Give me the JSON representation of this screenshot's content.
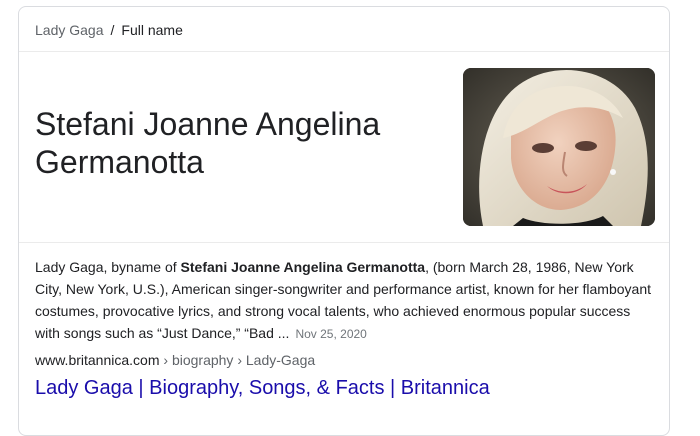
{
  "breadcrumb": {
    "parent": "Lady Gaga",
    "separator": "/",
    "current": "Full name"
  },
  "answer": {
    "full_name": "Stefani Joanne Angelina Germanotta"
  },
  "snippet": {
    "text_before": "Lady Gaga, byname of ",
    "bold": "Stefani Joanne Angelina Germanotta",
    "text_after": ", (born March 28, 1986, New York City, New York, U.S.), American singer-songwriter and performance artist, known for her flamboyant costumes, provocative lyrics, and strong vocal talents, who achieved enormous popular success with songs such as “Just Dance,” “Bad ...",
    "date": "Nov 25, 2020"
  },
  "source": {
    "domain": "www.britannica.com",
    "path": " › biography › Lady-Gaga",
    "title": "Lady Gaga | Biography, Songs, & Facts | Britannica"
  },
  "colors": {
    "link": "#1a0dab",
    "muted": "#5f6368",
    "border": "#dadce0"
  }
}
